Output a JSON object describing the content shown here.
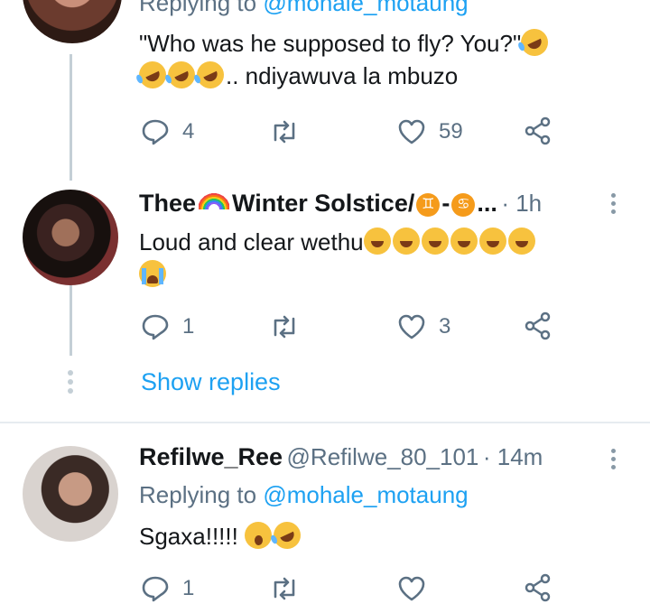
{
  "tweet1": {
    "replying_prefix": "Replying to ",
    "replying_handle": "@mohale_motaung",
    "text_line1": "\"Who was he supposed to fly? You?\"",
    "text_line2": ".. ndiyawuva la mbuzo",
    "reply_count": "4",
    "like_count": "59"
  },
  "tweet2": {
    "name_part1": "Thee",
    "name_part2": "Winter Solstice/",
    "name_part3": "-",
    "name_part4": "...",
    "time": "· 1h",
    "text": "Loud and clear wethu",
    "reply_count": "1",
    "like_count": "3",
    "show_replies": "Show replies"
  },
  "tweet3": {
    "name": "Refilwe_Ree",
    "handle": "@Refilwe_80_101",
    "time": "· 14m",
    "replying_prefix": "Replying to ",
    "replying_handle": "@mohale_motaung",
    "text": "Sgaxa!!!!!",
    "reply_count": "1",
    "like_count": ""
  },
  "icons": {
    "reply": "reply-icon",
    "retweet": "retweet-icon",
    "like": "heart-icon",
    "share": "share-icon",
    "more": "more-icon"
  },
  "colors": {
    "link": "#1da1f2",
    "meta": "#5b7083",
    "thread_line": "#c4cfd6"
  }
}
